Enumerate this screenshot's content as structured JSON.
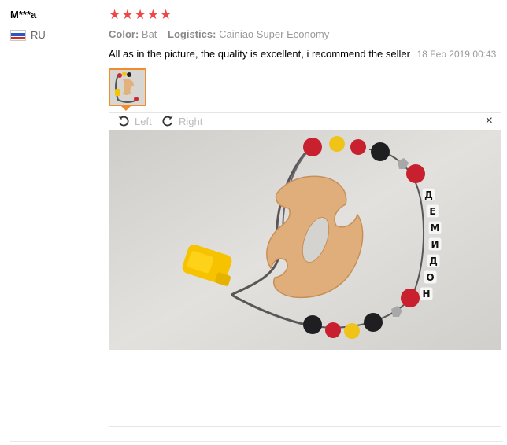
{
  "review": {
    "user_name": "M***a",
    "country": "RU",
    "rating": 5,
    "stars": [
      "★",
      "★",
      "★",
      "★",
      "★"
    ],
    "color_label": "Color:",
    "color_value": "Bat",
    "logistics_label": "Logistics:",
    "logistics_value": "Cainiao Super Economy",
    "text": "All as in the picture, the quality is excellent, i recommend the seller",
    "date": "18 Feb 2019 00:43"
  },
  "viewer": {
    "rotate_left_label": "Left",
    "rotate_right_label": "Right",
    "close_label": "×"
  },
  "photo": {
    "bead_letters": [
      "Д",
      "Е",
      "М",
      "И",
      "Д",
      "О",
      "Н"
    ]
  },
  "colors": {
    "star": "#f04646",
    "thumb_border": "#f08c2b"
  },
  "icons": {
    "rotate_left": "rotate-left-icon",
    "rotate_right": "rotate-right-icon",
    "close": "close-icon",
    "flag": "russia-flag-icon"
  }
}
